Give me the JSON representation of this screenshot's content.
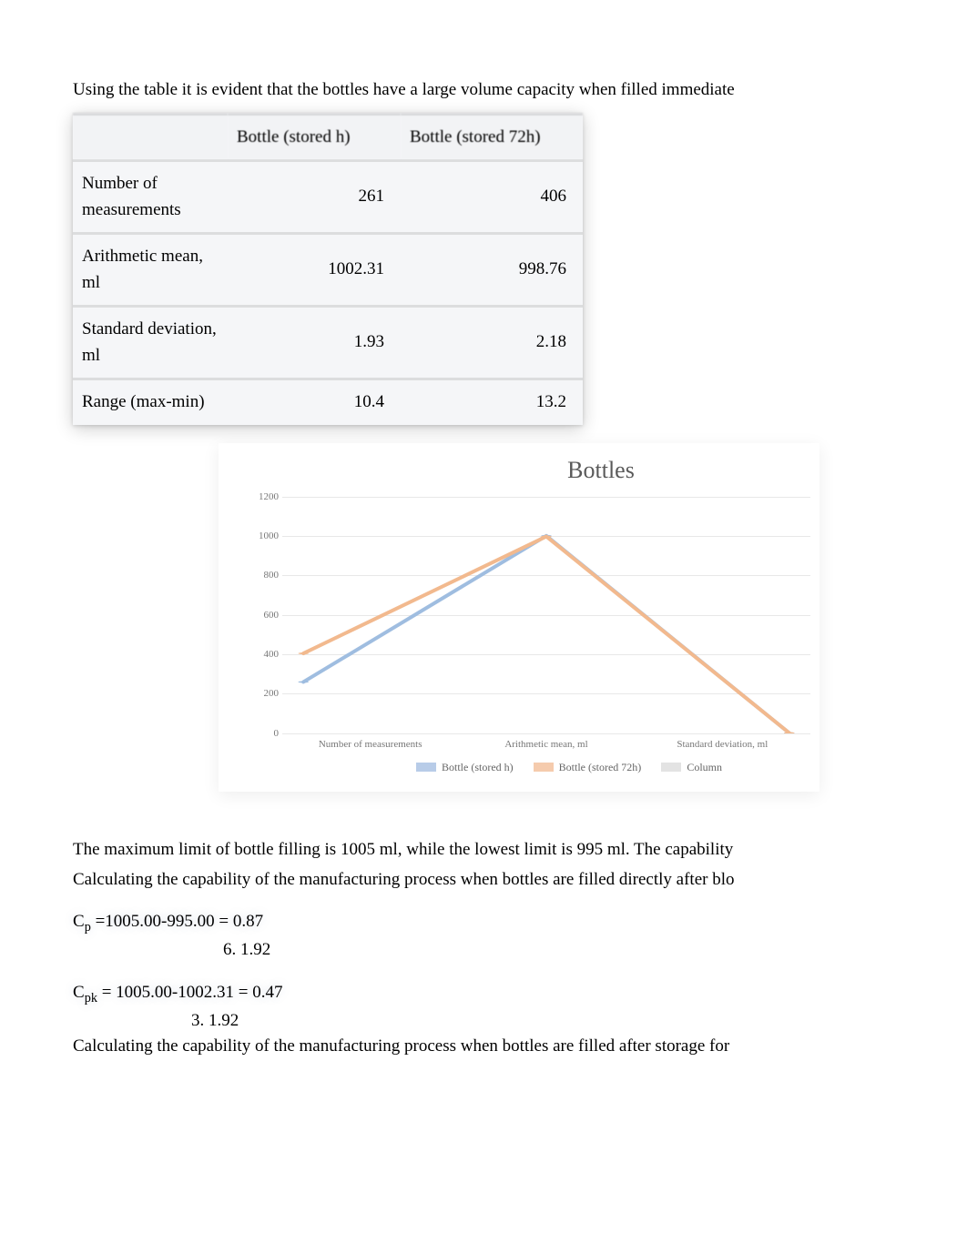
{
  "intro": "Using the table it is evident that the bottles have a large volume capacity when filled immediate",
  "table": {
    "headers": [
      "",
      "Bottle (stored h)",
      "Bottle (stored 72h)"
    ],
    "rows": [
      {
        "label": "Number of measurements",
        "c1": "261",
        "c2": "406"
      },
      {
        "label": "Arithmetic mean, ml",
        "c1": "1002.31",
        "c2": "998.76"
      },
      {
        "label": "Standard deviation, ml",
        "c1": "1.93",
        "c2": "2.18"
      },
      {
        "label": "Range (max-min)",
        "c1": "10.4",
        "c2": "13.2"
      }
    ]
  },
  "chart_data": {
    "type": "line",
    "title": "Bottles",
    "xlabel": "",
    "ylabel": "",
    "ylim": [
      0,
      1200
    ],
    "yticks": [
      0,
      200,
      400,
      600,
      800,
      1000,
      1200
    ],
    "categories": [
      "Number of measurements",
      "Arithmetic mean, ml",
      "Standard deviation, ml"
    ],
    "series": [
      {
        "name": "Bottle (stored h)",
        "color": "#9fbde0",
        "values": [
          261,
          1002.31,
          1.93
        ]
      },
      {
        "name": "Bottle (stored 72h)",
        "color": "#f2b98e",
        "values": [
          406,
          998.76,
          2.18
        ]
      },
      {
        "name": "Column",
        "color": "#dcdcdc",
        "values": [
          null,
          null,
          null
        ]
      }
    ]
  },
  "body": {
    "p1": "The maximum limit of bottle filling is 1005 ml, while the lowest limit is 995 ml. The capability",
    "p2": "Calculating the capability of the manufacturing process when bottles are filled directly after blo",
    "cp_label": "C",
    "cp_sub": "p",
    "cp_line1": " =1005.00-995.00 = 0.87",
    "cp_line2": "6. 1.92",
    "cpk_label": "C",
    "cpk_sub": "pk",
    "cpk_line1": " = 1005.00-1002.31 = 0.47",
    "cpk_line2": "3. 1.92",
    "p3": "Calculating the capability of the manufacturing process when bottles are filled after storage for"
  }
}
